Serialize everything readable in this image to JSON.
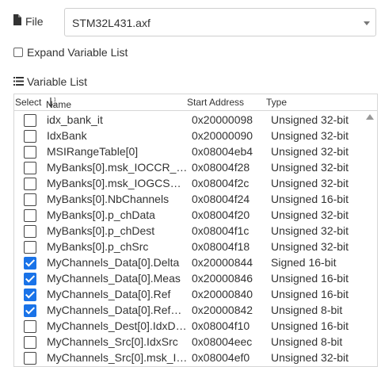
{
  "file": {
    "label": "File",
    "selected": "STM32L431.axf",
    "icon": "file-icon"
  },
  "expand": {
    "label": "Expand Variable List",
    "checked": false
  },
  "variable_list": {
    "title": "Variable List",
    "columns": {
      "select": "Select",
      "name": "Name",
      "start_address": "Start Address",
      "type": "Type"
    },
    "rows": [
      {
        "name": "idx_bank_it",
        "address": "0x20000098",
        "type": "Unsigned 32-bit",
        "checked": false
      },
      {
        "name": "IdxBank",
        "address": "0x20000090",
        "type": "Unsigned 32-bit",
        "checked": false
      },
      {
        "name": "MSIRangeTable[0]",
        "address": "0x08004eb4",
        "type": "Unsigned 32-bit",
        "checked": false
      },
      {
        "name": "MyBanks[0].msk_IOCCR_…",
        "address": "0x08004f28",
        "type": "Unsigned 32-bit",
        "checked": false
      },
      {
        "name": "MyBanks[0].msk_IOGCSR…",
        "address": "0x08004f2c",
        "type": "Unsigned 32-bit",
        "checked": false
      },
      {
        "name": "MyBanks[0].NbChannels",
        "address": "0x08004f24",
        "type": "Unsigned 16-bit",
        "checked": false
      },
      {
        "name": "MyBanks[0].p_chData",
        "address": "0x08004f20",
        "type": "Unsigned 32-bit",
        "checked": false
      },
      {
        "name": "MyBanks[0].p_chDest",
        "address": "0x08004f1c",
        "type": "Unsigned 32-bit",
        "checked": false
      },
      {
        "name": "MyBanks[0].p_chSrc",
        "address": "0x08004f18",
        "type": "Unsigned 32-bit",
        "checked": false
      },
      {
        "name": "MyChannels_Data[0].Delta",
        "address": "0x20000844",
        "type": "Signed 16-bit",
        "checked": true
      },
      {
        "name": "MyChannels_Data[0].Meas",
        "address": "0x20000846",
        "type": "Unsigned 16-bit",
        "checked": true
      },
      {
        "name": "MyChannels_Data[0].Ref",
        "address": "0x20000840",
        "type": "Unsigned 16-bit",
        "checked": true
      },
      {
        "name": "MyChannels_Data[0].RefR…",
        "address": "0x20000842",
        "type": "Unsigned 8-bit",
        "checked": true
      },
      {
        "name": "MyChannels_Dest[0].IdxDest",
        "address": "0x08004f10",
        "type": "Unsigned 16-bit",
        "checked": false
      },
      {
        "name": "MyChannels_Src[0].IdxSrc",
        "address": "0x08004eec",
        "type": "Unsigned 8-bit",
        "checked": false
      },
      {
        "name": "MyChannels_Src[0].msk_I…",
        "address": "0x08004ef0",
        "type": "Unsigned 32-bit",
        "checked": false
      }
    ]
  },
  "colors": {
    "checkbox_checked": "#1a73e8",
    "border": "#d6d6d6"
  }
}
